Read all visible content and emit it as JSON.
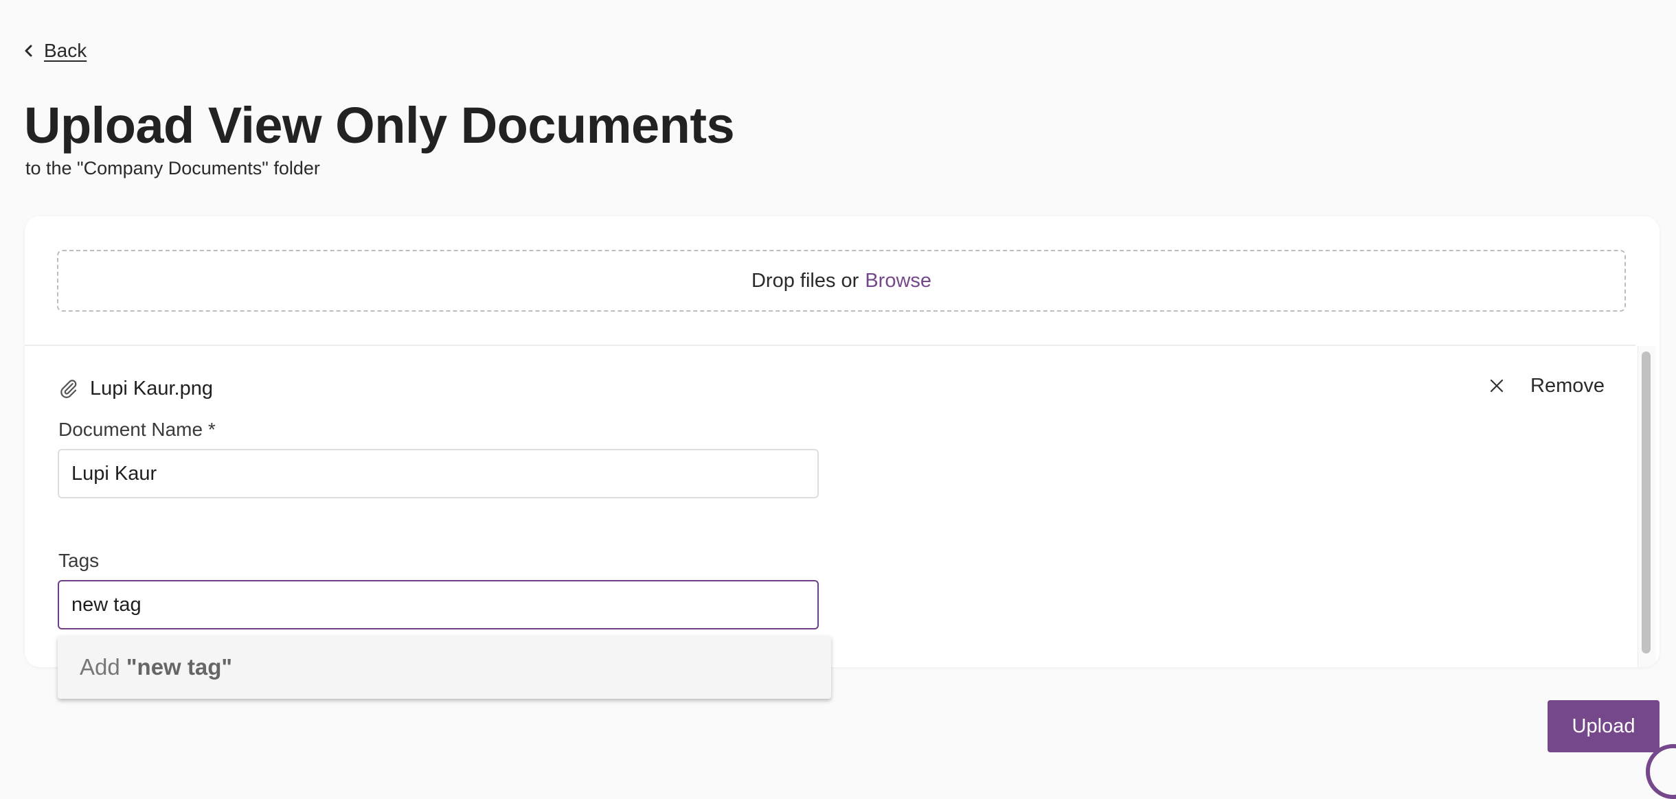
{
  "nav": {
    "back_label": "Back"
  },
  "page": {
    "title": "Upload View Only Documents",
    "subtitle": "to the \"Company Documents\" folder"
  },
  "dropzone": {
    "text": "Drop files or",
    "browse_label": "Browse"
  },
  "file": {
    "name": "Lupi Kaur.png",
    "remove_label": "Remove"
  },
  "form": {
    "document_name_label": "Document Name *",
    "document_name_value": "Lupi Kaur",
    "tags_label": "Tags",
    "tags_value": "new tag"
  },
  "suggestion": {
    "prefix": "Add ",
    "value": "\"new tag\""
  },
  "actions": {
    "upload_label": "Upload"
  },
  "icons": {
    "back": "chevron-left-icon",
    "attachment": "paperclip-icon",
    "remove": "close-icon"
  },
  "colors": {
    "accent": "#74488a",
    "focus": "#6e3f86",
    "background": "#fafafa"
  }
}
